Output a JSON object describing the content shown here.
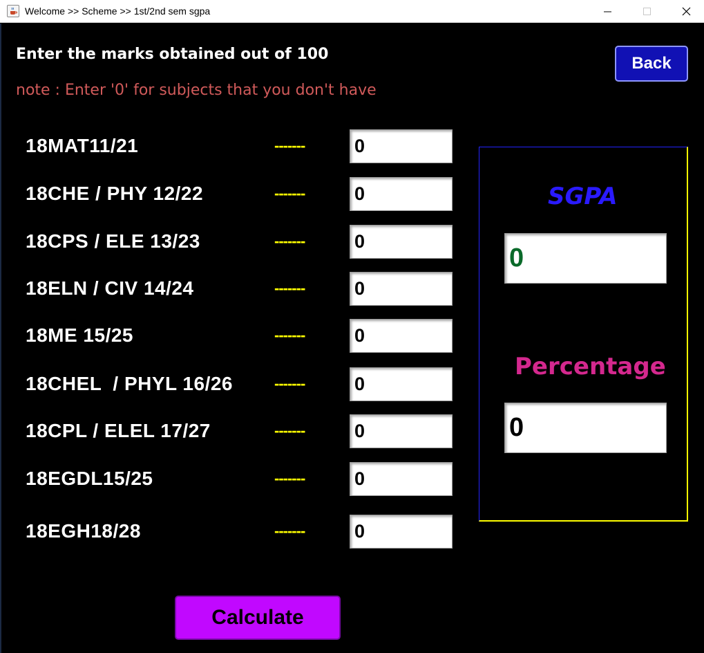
{
  "window": {
    "title": "Welcome >> Scheme >> 1st/2nd sem sgpa",
    "icon": "java-cup-icon",
    "controls": [
      "minimize",
      "maximize",
      "close"
    ]
  },
  "header": {
    "instruction": "Enter the marks obtained out of 100",
    "note": "note : Enter '0' for subjects that you don't have",
    "back_label": "Back"
  },
  "subjects": [
    {
      "code": "18MAT11/21",
      "separator": "-------",
      "mark": "0"
    },
    {
      "code": "18CHE / PHY 12/22",
      "separator": "-------",
      "mark": "0"
    },
    {
      "code": "18CPS / ELE 13/23",
      "separator": "-------",
      "mark": "0"
    },
    {
      "code": "18ELN / CIV 14/24",
      "separator": "-------",
      "mark": "0"
    },
    {
      "code": "18ME 15/25",
      "separator": "-------",
      "mark": "0"
    },
    {
      "code": "18CHEL  / PHYL 16/26",
      "separator": "-------",
      "mark": "0"
    },
    {
      "code": "18CPL / ELEL 17/27",
      "separator": "-------",
      "mark": "0"
    },
    {
      "code": "18EGDL15/25",
      "separator": "-------",
      "mark": "0"
    },
    {
      "code": "18EGH18/28",
      "separator": "-------",
      "mark": "0"
    }
  ],
  "results": {
    "sgpa_label": "SGPA",
    "sgpa_value": "0",
    "percentage_label": "Percentage",
    "percentage_value": "0"
  },
  "actions": {
    "calculate_label": "Calculate"
  },
  "colors": {
    "background": "#000000",
    "heading": "#ffffff",
    "note": "#d05a5a",
    "separator": "#ffff00",
    "back_button": "#1111b4",
    "sgpa_label": "#2a1aff",
    "sgpa_value": "#0a6a2a",
    "percentage_label": "#d4288e",
    "calculate_button": "#c108ff",
    "panel_border_top_left": "#2323ff",
    "panel_border_bottom_right": "#ffff00"
  }
}
